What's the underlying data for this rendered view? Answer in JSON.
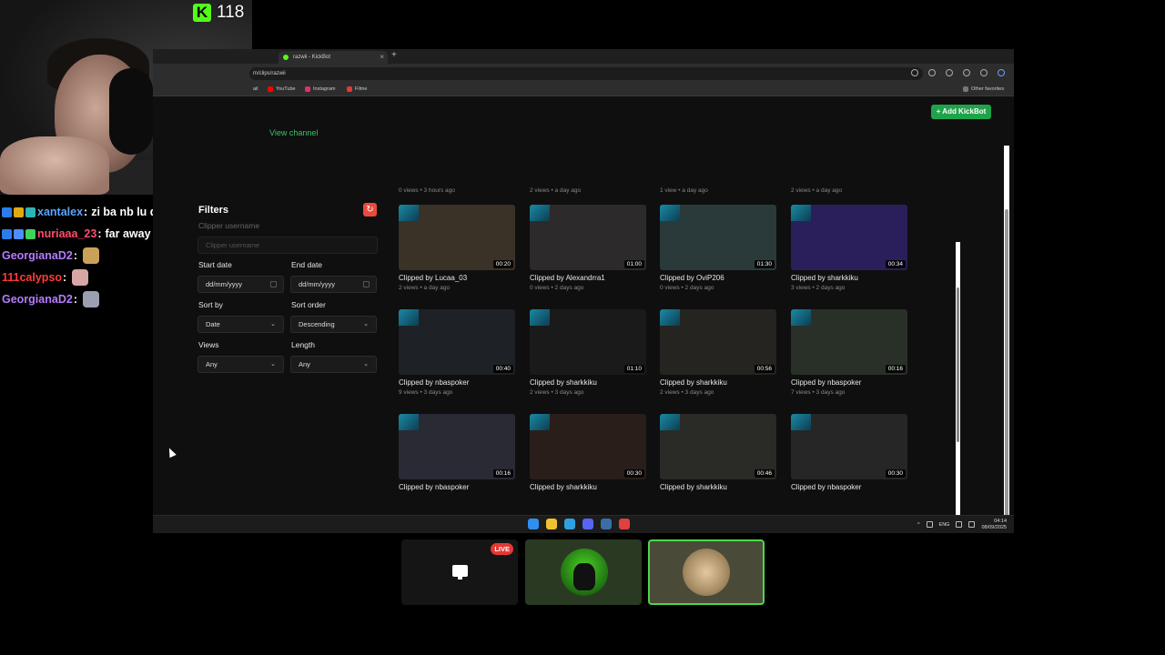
{
  "stream": {
    "viewer_count": "118",
    "kick_logo": "K"
  },
  "chat": [
    {
      "user": "xantalex",
      "color": "#58a6ff",
      "badges": [
        "#2b7de9",
        "#e0a812",
        "#2fb4b4"
      ],
      "msg": "zi ba nb lu dark",
      "emote": null
    },
    {
      "user": "nuriaaa_23",
      "color": "#ff4d6d",
      "badges": [
        "#2b7de9",
        "#4f8cff",
        "#3fd35c"
      ],
      "msg": "far away de la yebba si asap",
      "emote": null
    },
    {
      "user": "GeorgianaD2",
      "color": "#b57bff",
      "badges": [],
      "msg": "",
      "emote": "#c9a25a"
    },
    {
      "user": "111calypso",
      "color": "#ff3b3b",
      "badges": [],
      "msg": "",
      "emote": "#d9a6a6"
    },
    {
      "user": "GeorgianaD2",
      "color": "#b57bff",
      "badges": [],
      "msg": "",
      "emote": "#9aa0b0"
    }
  ],
  "browser": {
    "tab_title": "razwii - KickBot",
    "new_tab_symbol": "+",
    "url": "m/clips/razwii",
    "bookmarks": [
      {
        "label": "ail",
        "color": "#888888"
      },
      {
        "label": "YouTube",
        "color": "#ff0000"
      },
      {
        "label": "Instagram",
        "color": "#e1306c"
      },
      {
        "label": "Filme",
        "color": "#e53935"
      }
    ],
    "other_favorites": "Other favorites"
  },
  "page": {
    "add_button": "+ Add KickBot",
    "view_channel": "View channel",
    "filters": {
      "title": "Filters",
      "reset_icon": "↻",
      "clipper_label": "Clipper username",
      "clipper_placeholder": "Clipper username",
      "start_date_label": "Start date",
      "start_date_value": "dd/mm/yyyy",
      "end_date_label": "End date",
      "end_date_value": "dd/mm/yyyy",
      "sort_by_label": "Sort by",
      "sort_by_value": "Date",
      "sort_order_label": "Sort order",
      "sort_order_value": "Descending",
      "views_label": "Views",
      "views_value": "Any",
      "length_label": "Length",
      "length_value": "Any"
    },
    "prev_row_meta": [
      "0 views • 3 hours ago",
      "2 views • a day ago",
      "1 view • a day ago",
      "2 views • a day ago"
    ],
    "clips": [
      {
        "title": "Clipped by Lucaa_03",
        "meta": "2 views • a day ago",
        "duration": "00:20",
        "bg": "#3a3226"
      },
      {
        "title": "Clipped by Alexandrra1",
        "meta": "0 views • 2 days ago",
        "duration": "01:00",
        "bg": "#2c2a2a"
      },
      {
        "title": "Clipped by OviP206",
        "meta": "0 views • 2 days ago",
        "duration": "01:30",
        "bg": "#2a3a3a"
      },
      {
        "title": "Clipped by sharkkiku",
        "meta": "3 views • 2 days ago",
        "duration": "00:34",
        "bg": "#2a1f5a"
      },
      {
        "title": "Clipped by nbaspoker",
        "meta": "9 views • 3 days ago",
        "duration": "00:40",
        "bg": "#1e2226"
      },
      {
        "title": "Clipped by sharkkiku",
        "meta": "2 views • 3 days ago",
        "duration": "01:10",
        "bg": "#1a1a1a"
      },
      {
        "title": "Clipped by sharkkiku",
        "meta": "2 views • 3 days ago",
        "duration": "00:56",
        "bg": "#262420"
      },
      {
        "title": "Clipped by nbaspoker",
        "meta": "7 views • 3 days ago",
        "duration": "00:16",
        "bg": "#283028"
      },
      {
        "title": "Clipped by nbaspoker",
        "meta": "",
        "duration": "00:16",
        "bg": "#2a2a35"
      },
      {
        "title": "Clipped by sharkkiku",
        "meta": "",
        "duration": "00:30",
        "bg": "#2a1e1a"
      },
      {
        "title": "Clipped by sharkkiku",
        "meta": "",
        "duration": "00:46",
        "bg": "#2a2a26"
      },
      {
        "title": "Clipped by nbaspoker",
        "meta": "",
        "duration": "00:30",
        "bg": "#262626"
      }
    ]
  },
  "taskbar": {
    "icons": [
      "#2f8ff0",
      "#f0c030",
      "#2fa0e0",
      "#5865f2",
      "#3a6ea5",
      "#e04040"
    ],
    "lang": "ENG",
    "time": "04:14",
    "date": "08/09/2025"
  },
  "scenes": {
    "live_label": "LIVE"
  }
}
